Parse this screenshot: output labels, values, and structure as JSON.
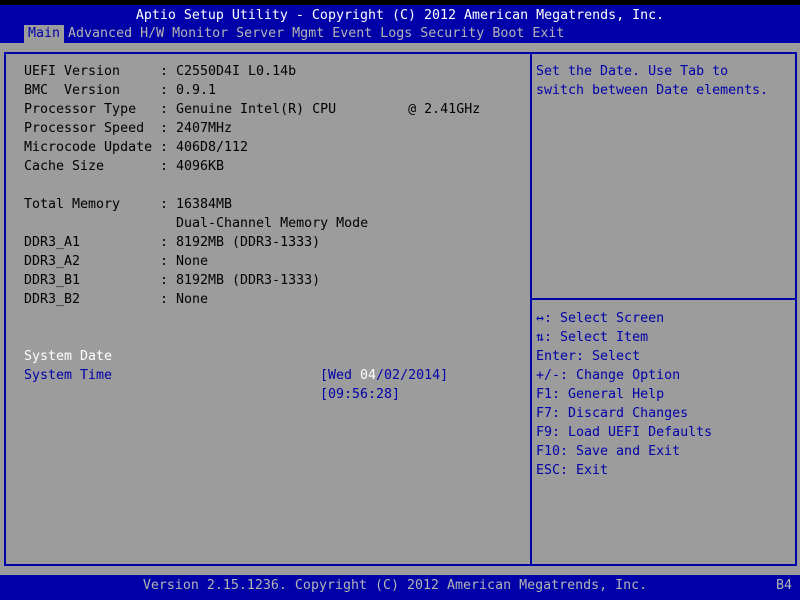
{
  "header": {
    "title": "Aptio Setup Utility - Copyright (C) 2012 American Megatrends, Inc."
  },
  "menu": [
    "Main",
    "Advanced",
    "H/W Monitor",
    "Server Mgmt",
    "Event Logs",
    "Security",
    "Boot",
    "Exit"
  ],
  "active_tab": "Main",
  "info": [
    {
      "label": "UEFI Version",
      "value": "C2550D4I L0.14b"
    },
    {
      "label": "BMC  Version",
      "value": "0.9.1"
    },
    {
      "label": "Processor Type",
      "value": "Genuine Intel(R) CPU         @ 2.41GHz"
    },
    {
      "label": "Processor Speed",
      "value": "2407MHz"
    },
    {
      "label": "Microcode Update",
      "value": "406D8/112"
    },
    {
      "label": "Cache Size",
      "value": "4096KB"
    },
    {
      "label": "Total Memory",
      "value": "16384MB"
    },
    {
      "label": "",
      "value": "Dual-Channel Memory Mode"
    },
    {
      "label": "DDR3_A1",
      "value": "8192MB (DDR3-1333)"
    },
    {
      "label": "DDR3_A2",
      "value": "None"
    },
    {
      "label": "DDR3_B1",
      "value": "8192MB (DDR3-1333)"
    },
    {
      "label": "DDR3_B2",
      "value": "None"
    }
  ],
  "system_date": {
    "label": "System Date",
    "prefix": "[Wed ",
    "selected": "04",
    "suffix": "/02/2014]"
  },
  "system_time": {
    "label": "System Time",
    "value": "[09:56:28]"
  },
  "help_text": [
    "Set the Date. Use Tab to",
    "switch between Date elements."
  ],
  "keys": [
    "↔: Select Screen",
    "⇅: Select Item",
    "Enter: Select",
    "+/-: Change Option",
    "F1: General Help",
    "F7: Discard Changes",
    "F9: Load UEFI Defaults",
    "F10: Save and Exit",
    "ESC: Exit"
  ],
  "footer": {
    "version": "Version 2.15.1236. Copyright (C) 2012 American Megatrends, Inc.",
    "code": "B4"
  },
  "colors": {
    "blue": "#0000a8",
    "gray": "#9c9c9c",
    "selected": "#ffffff"
  }
}
